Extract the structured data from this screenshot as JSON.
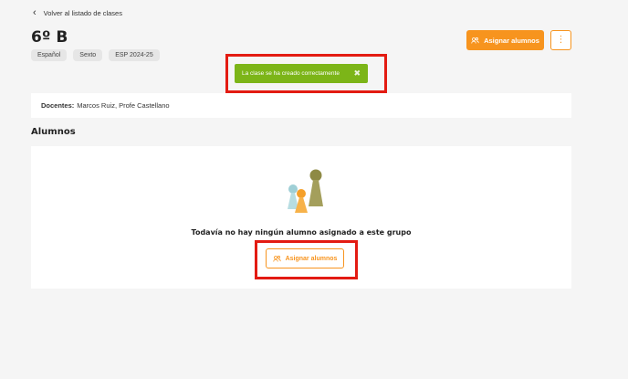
{
  "nav": {
    "back_label": "Volver al listado de clases"
  },
  "header": {
    "title": "6º B",
    "tags": [
      "Español",
      "Sexto",
      "ESP 2024-25"
    ],
    "assign_button_label": "Asignar alumnos",
    "more_menu_glyph": "⋮"
  },
  "toast": {
    "message": "La clase se ha creado correctamente",
    "close_glyph": "✖"
  },
  "teachers": {
    "label": "Docentes:",
    "value": "Marcos Ruiz, Profe Castellano"
  },
  "students": {
    "section_title": "Alumnos",
    "empty_message": "Todavía no hay ningún alumno asignado a este grupo",
    "assign_button_label": "Asignar alumnos"
  },
  "colors": {
    "accent": "#f7941e",
    "success": "#7cb518",
    "highlight": "#e31b12"
  },
  "icons": {
    "back": "chevron-left-icon",
    "assign": "assign-students-icon",
    "more": "more-vertical-icon",
    "close": "close-icon",
    "illustration": "game-pieces-illustration"
  }
}
